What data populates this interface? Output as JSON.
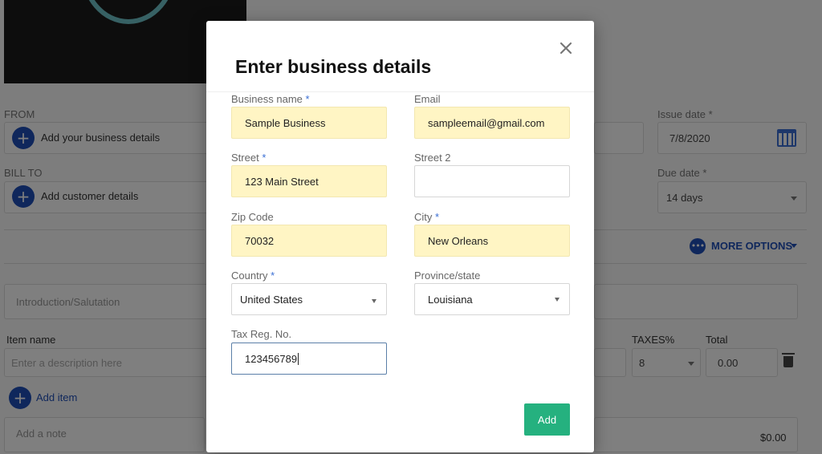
{
  "background": {
    "from_label": "FROM",
    "add_business": "Add your business details",
    "bill_to_label": "BILL TO",
    "add_customer": "Add customer details",
    "issue_date_label": "Issue date *",
    "issue_date_value": "7/8/2020",
    "due_date_label": "Due date *",
    "due_date_value": "14 days",
    "more_options": "MORE OPTIONS",
    "intro_placeholder": "Introduction/Salutation",
    "item_name_header": "Item name",
    "taxes_header": "TAXES%",
    "total_header": "Total",
    "description_placeholder": "Enter a description here",
    "taxes_value": "8",
    "total_value": "0.00",
    "add_item": "Add item",
    "add_note": "Add a note",
    "grand_total": "$0.00"
  },
  "modal": {
    "title": "Enter business details",
    "fields": {
      "business_name": {
        "label": "Business name",
        "required": "*",
        "value": "Sample Business"
      },
      "email": {
        "label": "Email",
        "value": "sampleemail@gmail.com"
      },
      "street": {
        "label": "Street",
        "required": "*",
        "value": "123 Main Street"
      },
      "street2": {
        "label": "Street 2",
        "value": ""
      },
      "zip": {
        "label": "Zip Code",
        "value": "70032"
      },
      "city": {
        "label": "City",
        "required": "*",
        "value": "New Orleans"
      },
      "country": {
        "label": "Country",
        "required": "*",
        "value": "United States"
      },
      "province": {
        "label": "Province/state",
        "value": "Louisiana"
      },
      "tax_reg": {
        "label": "Tax Reg. No.",
        "value": "123456789"
      }
    },
    "add_button": "Add"
  },
  "colors": {
    "accent_blue": "#1f4fb8",
    "filled_field": "#fff5c4",
    "add_button": "#25b17f"
  }
}
